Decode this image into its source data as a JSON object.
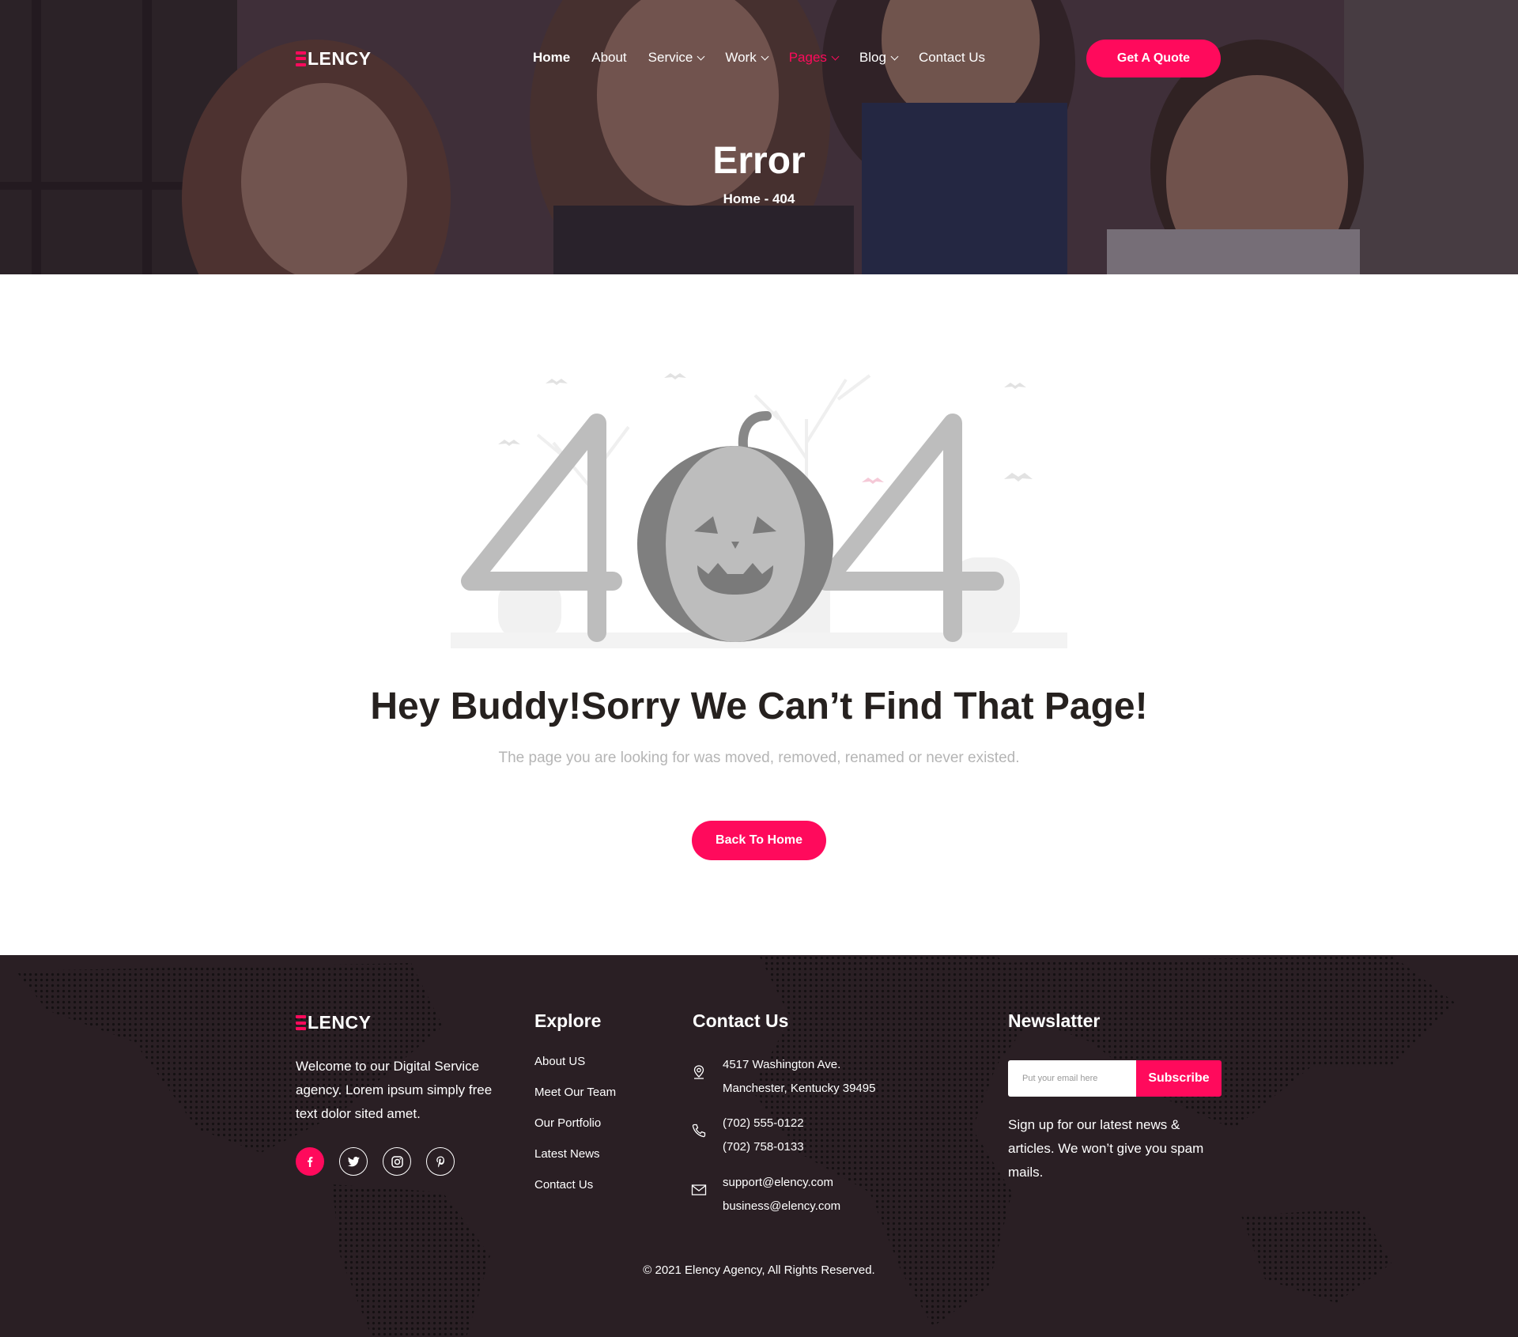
{
  "brand": {
    "name": "LENCY",
    "accent": "#ff0a5c",
    "footer_bg": "#2a1f24"
  },
  "nav": {
    "items": [
      {
        "label": "Home"
      },
      {
        "label": "About"
      },
      {
        "label": "Service"
      },
      {
        "label": "Work"
      },
      {
        "label": "Pages"
      },
      {
        "label": "Blog"
      },
      {
        "label": "Contact Us"
      }
    ],
    "quote_button": "Get A Quote"
  },
  "hero": {
    "title": "Error",
    "breadcrumb": "Home - 404"
  },
  "error": {
    "graphic_text": "404",
    "headline": "Hey Buddy!Sorry We Can’t Find That Page!",
    "message": "The page you are looking for was moved, removed, renamed or never existed.",
    "button": "Back To Home"
  },
  "footer": {
    "about": "Welcome to our Digital Service agency. Lorem ipsum simply free text dolor sited amet.",
    "socials": [
      "facebook-icon",
      "twitter-icon",
      "instagram-icon",
      "pinterest-icon"
    ],
    "explore": {
      "heading": "Explore",
      "links": [
        "About US",
        "Meet Our Team",
        "Our Portfolio",
        "Latest News",
        "Contact Us"
      ]
    },
    "contact": {
      "heading": "Contact Us",
      "address": [
        "4517 Washington Ave.",
        "Manchester, Kentucky 39495"
      ],
      "phones": [
        "(702) 555-0122",
        "(702) 758-0133"
      ],
      "emails": [
        "support@elency.com",
        "business@elency.com"
      ]
    },
    "newsletter": {
      "heading": "Newslatter",
      "placeholder": "Put your email here",
      "button": "Subscribe",
      "text": "Sign up for our latest news & articles. We won’t give you spam mails."
    },
    "copyright": "© 2021 Elency Agency, All Rights Reserved."
  }
}
